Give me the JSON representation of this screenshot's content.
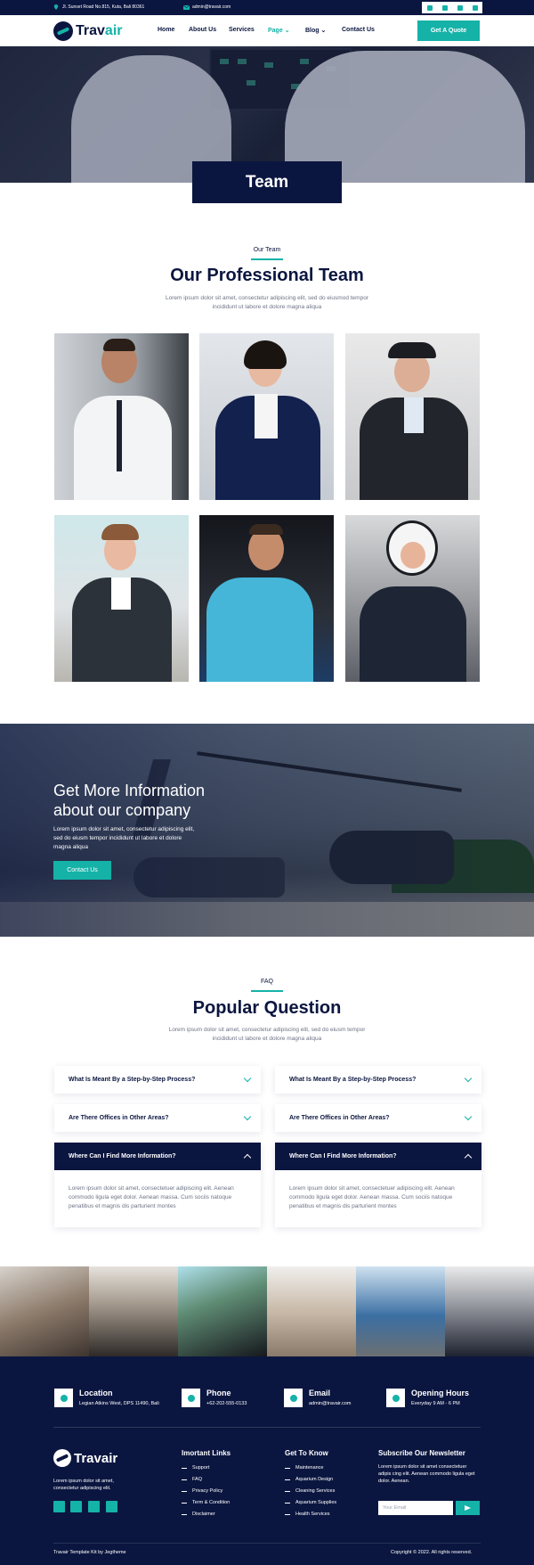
{
  "topbar": {
    "address": "Jl. Sunset Road No.815, Kuta, Bali 80361",
    "email": "admin@travair.com",
    "social_icons": [
      "facebook-icon",
      "twitter-icon",
      "instagram-icon",
      "youtube-icon"
    ]
  },
  "brand": {
    "name_part1": "Trav",
    "name_part2": "air"
  },
  "nav": {
    "items": [
      {
        "label": "Home",
        "active": false
      },
      {
        "label": "About Us",
        "active": false
      },
      {
        "label": "Services",
        "active": false
      },
      {
        "label": "Page",
        "active": true
      },
      {
        "label": "Blog",
        "active": false
      },
      {
        "label": "Contact Us",
        "active": false
      }
    ],
    "cta": "Get A Quote"
  },
  "hero": {
    "title": "Team"
  },
  "team": {
    "tag": "Our Team",
    "title": "Our Professional Team",
    "lead": "Lorem ipsum dolor sit amet, consectetur adipiscing elit, sed do eiusmod tempor incididunt ut labore et dolore magna aliqua"
  },
  "cta": {
    "title": "Get More Information about our company",
    "text": "Lorem ipsum dolor sit amet, consectetur adipiscing elit, sed do eiusm tempor incididunt ut labore et dolore magna aliqua",
    "button": "Contact Us"
  },
  "faq": {
    "tag": "FAQ",
    "title": "Popular Question",
    "lead": "Lorem ipsum dolor sit amet, consectetur adipiscing elit, sed do eiusm tempor incididunt ut labore et dolore magna aliqua",
    "left": [
      {
        "q": "What Is Meant By a Step-by-Step Process?"
      },
      {
        "q": "Are There Offices in Other Areas?"
      },
      {
        "q": "Where Can I Find More Information?"
      }
    ],
    "right": [
      {
        "q": "What Is Meant By a Step-by-Step Process?"
      },
      {
        "q": "Are There Offices in Other Areas?"
      },
      {
        "q": "Where Can I Find More Information?"
      }
    ],
    "answer": "Lorem ipsum dolor sit amet, consectetuer adipiscing elit. Aenean commodo ligula eget dolor. Aenean massa. Cum sociis natoque penatibus et magnis dis parturient montes"
  },
  "footer": {
    "info": [
      {
        "title": "Location",
        "text": "Legian Atkins West, DPS 11490, Bali",
        "icon": "map-pin-icon"
      },
      {
        "title": "Phone",
        "text": "+62-202-555-0133",
        "icon": "phone-icon"
      },
      {
        "title": "Email",
        "text": "admin@travair.com",
        "icon": "envelope-icon"
      },
      {
        "title": "Opening Hours",
        "text": "Everyday 9 AM - 6 PM",
        "icon": "clock-icon"
      }
    ],
    "about": "Lorem ipsum dolor sit amet, consectetur adipiscing elit.",
    "links_title": "Imortant Links",
    "links": [
      "Support",
      "FAQ",
      "Privacy Policy",
      "Term & Condition",
      "Disclaimer"
    ],
    "know_title": "Get To Know",
    "know": [
      "Maintenance",
      "Aquarium Design",
      "Cleaning Services",
      "Aquarium Supplies",
      "Health Services"
    ],
    "newsletter_title": "Subscribe Our Newsletter",
    "newsletter_text": "Lorem ipsum dolor sit amet consectetuer adipis cing elit. Aenean commodo ligula eget dolor. Aenean.",
    "newsletter_placeholder": "Your Email",
    "credit": "Travair Template Kit by Jegtheme",
    "copyright": "Copyright © 2022. All rights reserved."
  },
  "colors": {
    "navy": "#0b1640",
    "teal": "#15b2a8"
  }
}
